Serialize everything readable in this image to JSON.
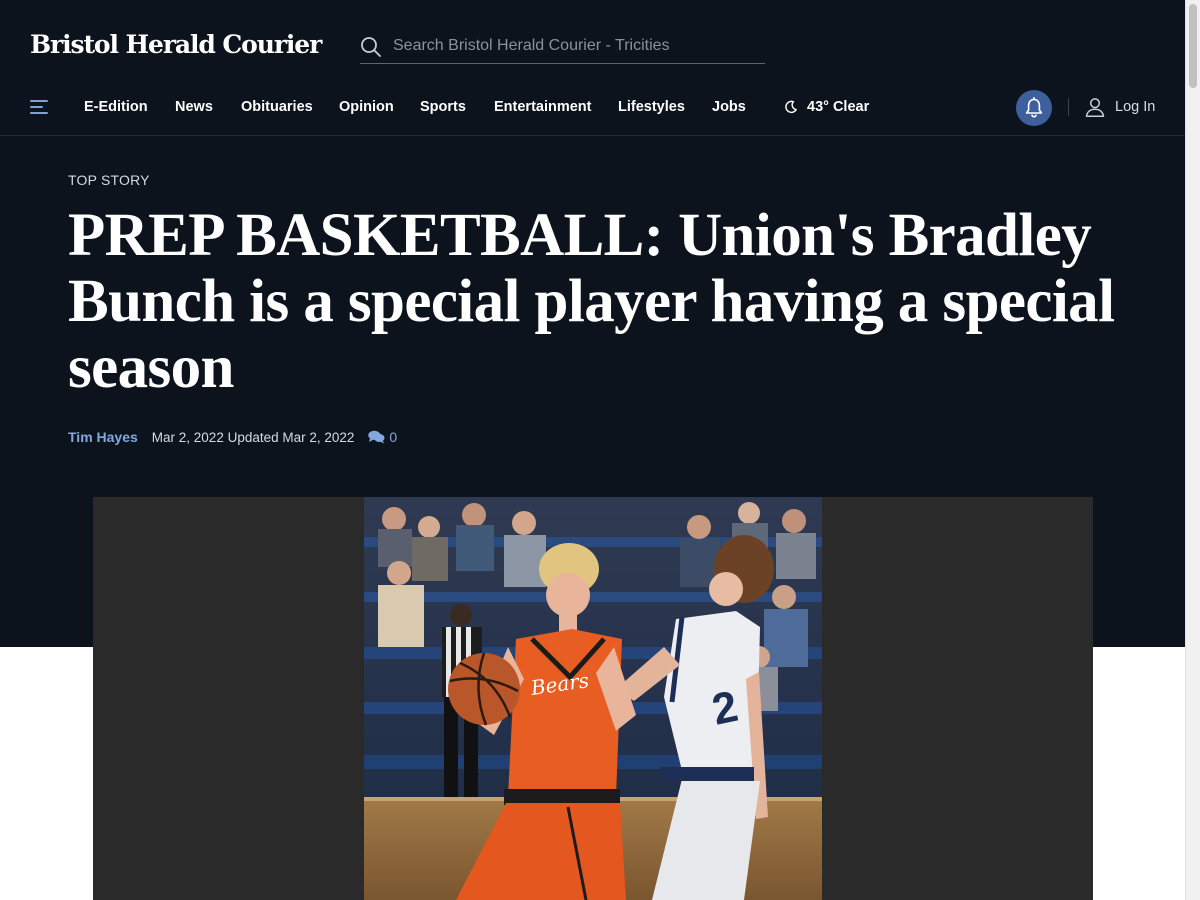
{
  "site": {
    "masthead": "Bristol Herald Courier"
  },
  "search": {
    "placeholder": "Search Bristol Herald Courier - Tricities"
  },
  "nav": {
    "items": [
      {
        "label": "E-Edition"
      },
      {
        "label": "News"
      },
      {
        "label": "Obituaries"
      },
      {
        "label": "Opinion"
      },
      {
        "label": "Sports"
      },
      {
        "label": "Entertainment"
      },
      {
        "label": "Lifestyles"
      },
      {
        "label": "Jobs"
      }
    ],
    "weather": "43° Clear",
    "login_label": "Log In"
  },
  "article": {
    "kicker": "TOP STORY",
    "headline": "PREP BASKETBALL: Union's Bradley Bunch is a special player having a special season",
    "author": "Tim Hayes",
    "dates": "Mar 2, 2022 Updated Mar 2, 2022",
    "comment_count": "0",
    "jersey_text": "Bears"
  },
  "icons": {
    "menu": "menu-icon",
    "search": "search-icon",
    "weather": "moon-icon",
    "notifications": "bell-icon",
    "account": "user-icon",
    "comments": "comments-icon"
  },
  "colors": {
    "header_background": "#0c131d",
    "accent_blue": "#84a7dd",
    "bell_background": "#3e5f9e",
    "jersey_orange": "#e85d22"
  }
}
